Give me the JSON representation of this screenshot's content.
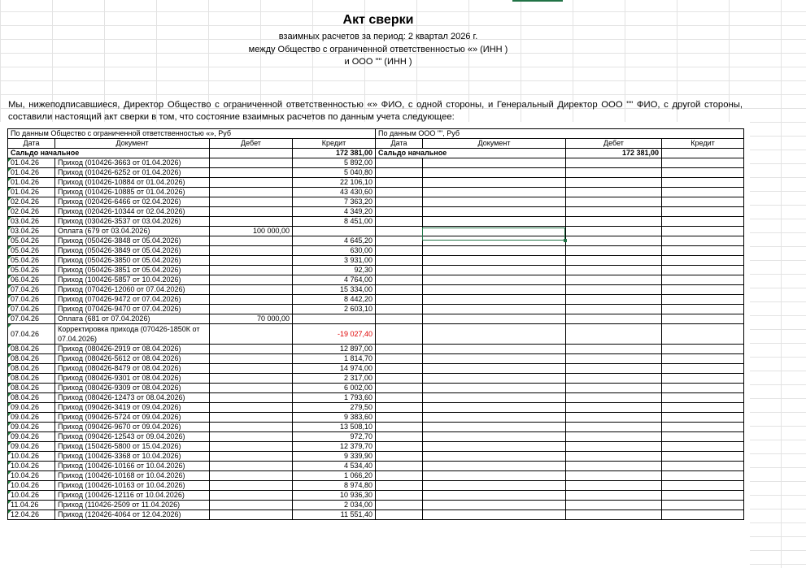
{
  "header": {
    "title": "Акт сверки",
    "period": "взаимных расчетов за период: 2 квартал 2026 г.",
    "between": "между Общество с ограниченной ответственностью «» (ИНН )",
    "and": "и ООО \"\" (ИНН )"
  },
  "intro": "Мы, нижеподписавшиеся, Директор Общество с ограниченной ответственностью «» ФИО, с одной стороны, и Генеральный Директор ООО \"\" ФИО, с другой стороны, составили настоящий акт сверки в том, что состояние взаимных расчетов по данным учета следующее:",
  "left_header": "По данным Общество с ограниченной ответственностью «», Руб",
  "right_header": "По данным ООО \"\", Руб",
  "columns": {
    "date": "Дата",
    "document": "Документ",
    "debit": "Дебет",
    "credit": "Кредит"
  },
  "opening": {
    "label": "Сальдо начальное",
    "left_credit": "172 381,00",
    "right_debit": "172 381,00"
  },
  "rows": [
    {
      "date": "01.04.26",
      "doc": "Приход (010426-3663 от 01.04.2026)",
      "debit": "",
      "credit": "5 892,00"
    },
    {
      "date": "01.04.26",
      "doc": "Приход (010426-6252 от 01.04.2026)",
      "debit": "",
      "credit": "5 040,80"
    },
    {
      "date": "01.04.26",
      "doc": "Приход (010426-10884 от 01.04.2026)",
      "debit": "",
      "credit": "22 106,10"
    },
    {
      "date": "01.04.26",
      "doc": "Приход (010426-10885 от 01.04.2026)",
      "debit": "",
      "credit": "43 430,60"
    },
    {
      "date": "02.04.26",
      "doc": "Приход (020426-6466 от 02.04.2026)",
      "debit": "",
      "credit": "7 363,20"
    },
    {
      "date": "02.04.26",
      "doc": "Приход (020426-10344 от 02.04.2026)",
      "debit": "",
      "credit": "4 349,20"
    },
    {
      "date": "03.04.26",
      "doc": "Приход (030426-3537 от 03.04.2026)",
      "debit": "",
      "credit": "8 451,00"
    },
    {
      "date": "03.04.26",
      "doc": "Оплата (679 от 03.04.2026)",
      "debit": "100 000,00",
      "credit": ""
    },
    {
      "date": "05.04.26",
      "doc": "Приход (050426-3848 от 05.04.2026)",
      "debit": "",
      "credit": "4 645,20"
    },
    {
      "date": "05.04.26",
      "doc": "Приход (050426-3849 от 05.04.2026)",
      "debit": "",
      "credit": "630,00"
    },
    {
      "date": "05.04.26",
      "doc": "Приход (050426-3850 от 05.04.2026)",
      "debit": "",
      "credit": "3 931,00"
    },
    {
      "date": "05.04.26",
      "doc": "Приход (050426-3851 от 05.04.2026)",
      "debit": "",
      "credit": "92,30"
    },
    {
      "date": "06.04.26",
      "doc": "Приход (100426-5857 от 10.04.2026)",
      "debit": "",
      "credit": "4 764,00"
    },
    {
      "date": "07.04.26",
      "doc": "Приход (070426-12060 от 07.04.2026)",
      "debit": "",
      "credit": "15 334,00"
    },
    {
      "date": "07.04.26",
      "doc": "Приход (070426-9472 от 07.04.2026)",
      "debit": "",
      "credit": "8 442,20"
    },
    {
      "date": "07.04.26",
      "doc": "Приход (070426-9470 от 07.04.2026)",
      "debit": "",
      "credit": "2 603,10"
    },
    {
      "date": "07.04.26",
      "doc": "Оплата (681 от 07.04.2026)",
      "debit": "70 000,00",
      "credit": ""
    },
    {
      "date": "07.04.26",
      "doc": "Корректировка прихода (070426-1850К от 07.04.2026)",
      "debit": "",
      "credit": "-19 027,40",
      "red": true
    },
    {
      "date": "08.04.26",
      "doc": "Приход (080426-2919 от 08.04.2026)",
      "debit": "",
      "credit": "12 897,00"
    },
    {
      "date": "08.04.26",
      "doc": "Приход (080426-5612 от 08.04.2026)",
      "debit": "",
      "credit": "1 814,70"
    },
    {
      "date": "08.04.26",
      "doc": "Приход (080426-8479 от 08.04.2026)",
      "debit": "",
      "credit": "14 974,00"
    },
    {
      "date": "08.04.26",
      "doc": "Приход (080426-9301 от 08.04.2026)",
      "debit": "",
      "credit": "2 317,00"
    },
    {
      "date": "08.04.26",
      "doc": "Приход (080426-9309 от 08.04.2026)",
      "debit": "",
      "credit": "6 002,00"
    },
    {
      "date": "08.04.26",
      "doc": "Приход (080426-12473 от 08.04.2026)",
      "debit": "",
      "credit": "1 793,60"
    },
    {
      "date": "09.04.26",
      "doc": "Приход (090426-3419 от 09.04.2026)",
      "debit": "",
      "credit": "279,50"
    },
    {
      "date": "09.04.26",
      "doc": "Приход (090426-5724 от 09.04.2026)",
      "debit": "",
      "credit": "9 383,60"
    },
    {
      "date": "09.04.26",
      "doc": "Приход (090426-9670 от 09.04.2026)",
      "debit": "",
      "credit": "13 508,10"
    },
    {
      "date": "09.04.26",
      "doc": "Приход (090426-12543 от 09.04.2026)",
      "debit": "",
      "credit": "972,70"
    },
    {
      "date": "09.04.26",
      "doc": "Приход (150426-5800 от 15.04.2026)",
      "debit": "",
      "credit": "12 379,70"
    },
    {
      "date": "10.04.26",
      "doc": "Приход (100426-3368 от 10.04.2026)",
      "debit": "",
      "credit": "9 339,90"
    },
    {
      "date": "10.04.26",
      "doc": "Приход (100426-10166 от 10.04.2026)",
      "debit": "",
      "credit": "4 534,40"
    },
    {
      "date": "10.04.26",
      "doc": "Приход (100426-10168 от 10.04.2026)",
      "debit": "",
      "credit": "1 066,20"
    },
    {
      "date": "10.04.26",
      "doc": "Приход (100426-10163 от 10.04.2026)",
      "debit": "",
      "credit": "8 974,80"
    },
    {
      "date": "10.04.26",
      "doc": "Приход (100426-12116 от 10.04.2026)",
      "debit": "",
      "credit": "10 936,30"
    },
    {
      "date": "11.04.26",
      "doc": "Приход (110426-2509 от 11.04.2026)",
      "debit": "",
      "credit": "2 034,00"
    },
    {
      "date": "12.04.26",
      "doc": "Приход (120426-4064 от 12.04.2026)",
      "debit": "",
      "credit": "11 551,40"
    }
  ]
}
